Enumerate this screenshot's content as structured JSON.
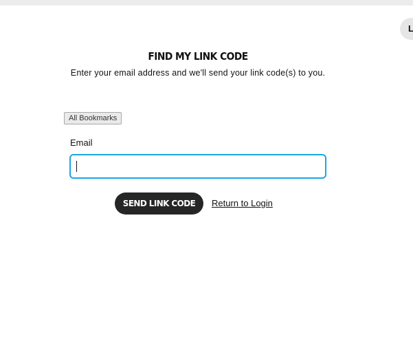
{
  "header": {
    "corner_badge_label": "L"
  },
  "main": {
    "title": "FIND MY LINK CODE",
    "subtitle": "Enter your email address and we'll send your link code(s) to you."
  },
  "bookmarks": {
    "label": "All Bookmarks"
  },
  "form": {
    "email_label": "Email",
    "email_value": "",
    "email_placeholder": "",
    "send_button_label": "SEND LINK CODE",
    "return_link_label": "Return to Login"
  },
  "colors": {
    "input_focus_border": "#1aa6e4",
    "button_background": "#262626",
    "button_text": "#ffffff"
  }
}
